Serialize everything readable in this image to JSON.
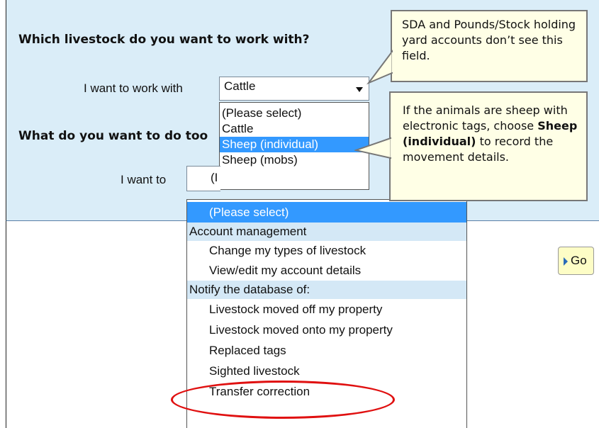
{
  "questions": {
    "livestock_heading": "Which livestock do you want to work with?",
    "livestock_label": "I want to work with",
    "livestock_value": "Cattle",
    "livestock_options": [
      "(Please select)",
      "Cattle",
      "Sheep (individual)",
      "Sheep (mobs)"
    ],
    "livestock_selected_index": 2,
    "todo_heading": "What do you want to do too",
    "todo_label": "I want to",
    "todo_value": "(I"
  },
  "action_list": {
    "items": [
      {
        "text": "(Please select)",
        "kind": "selected"
      },
      {
        "text": "Account management",
        "kind": "group"
      },
      {
        "text": "Change my types of livestock",
        "kind": "indent"
      },
      {
        "text": "View/edit my account details",
        "kind": "indent"
      },
      {
        "text": "Notify the database of:",
        "kind": "group"
      },
      {
        "text": "Livestock moved off my property",
        "kind": "indent"
      },
      {
        "text": "Livestock moved onto my property",
        "kind": "indent"
      },
      {
        "text": "Replaced tags",
        "kind": "indent"
      },
      {
        "text": "Sighted livestock",
        "kind": "indent"
      },
      {
        "text": "Transfer correction",
        "kind": "indent"
      }
    ]
  },
  "go_button": {
    "label": "Go"
  },
  "callouts": {
    "top_text": "SDA and Pounds/Stock holding yard accounts don’t see this field.",
    "second_pre": "If the animals are sheep with electronic tags, choose ",
    "second_bold": "Sheep (individual)",
    "second_post": " to record the movement details."
  },
  "colors": {
    "panel_bg": "#daedf8",
    "selected_bg": "#3399ff",
    "group_bg": "#d4e8f6",
    "callout_bg": "#ffffe6",
    "highlight_ring": "#e01010"
  }
}
